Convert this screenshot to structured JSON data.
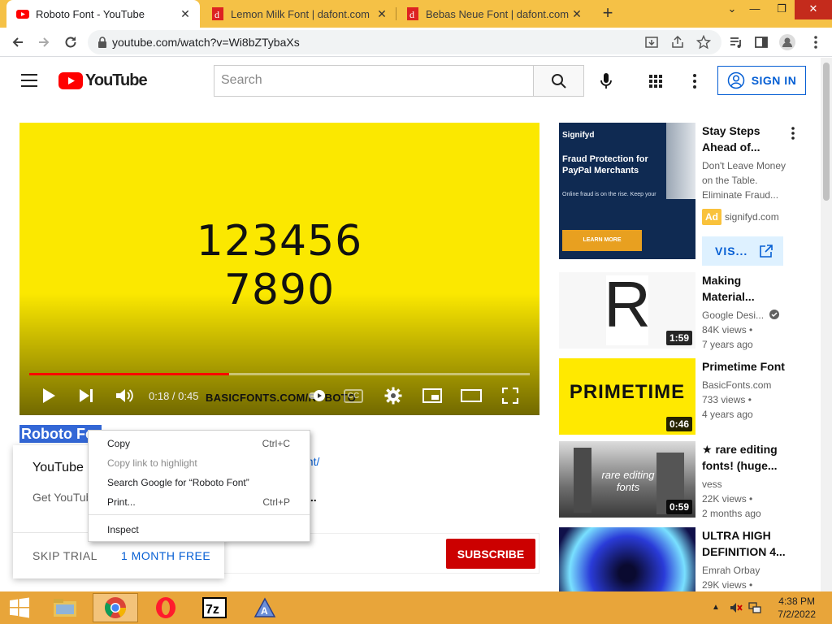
{
  "browser": {
    "tabs": [
      {
        "title": "Roboto Font - YouTube",
        "active": true
      },
      {
        "title": "Lemon Milk Font | dafont.com",
        "active": false
      },
      {
        "title": "Bebas Neue Font | dafont.com",
        "active": false
      }
    ],
    "url": "youtube.com/watch?v=Wi8bZTybaXs"
  },
  "header": {
    "logo_text": "YouTube",
    "search_placeholder": "Search",
    "signin_label": "SIGN IN"
  },
  "player": {
    "line1": "123456",
    "line2": "7890",
    "time": "0:18 / 0:45",
    "watermark": "BASICFONTS.COM/ROBOTO",
    "progress": 0.4,
    "cc_label": "CC"
  },
  "video": {
    "title_visible": "Roboto Fon",
    "link_fragment": "ont/",
    "dots": "...",
    "subscribe_label": "SUBSCRIBE"
  },
  "trial_popup": {
    "title": "YouTube",
    "body": "Get YouTub",
    "skip_label": "SKIP TRIAL",
    "free_label": "1 MONTH FREE"
  },
  "context_menu": {
    "items": [
      {
        "label": "Copy",
        "shortcut": "Ctrl+C",
        "enabled": true
      },
      {
        "label": "Copy link to highlight",
        "shortcut": "",
        "enabled": false
      },
      {
        "label": "Search Google for “Roboto Font”",
        "shortcut": "",
        "enabled": true
      },
      {
        "label": "Print...",
        "shortcut": "Ctrl+P",
        "enabled": true
      },
      {
        "label": "Inspect",
        "shortcut": "",
        "enabled": true
      }
    ]
  },
  "sidebar": {
    "ad": {
      "title": "Stay Steps Ahead of...",
      "desc": "Don't Leave Money on the Table. Eliminate Fraud...",
      "badge": "Ad",
      "domain": "signifyd.com",
      "visit_label": "VIS...",
      "thumb_brand": "Signifyd",
      "thumb_heading": "Fraud Protection for PayPal Merchants",
      "thumb_body": "Online fraud is on the rise. Keep your business protected.",
      "thumb_cta": "LEARN MORE"
    },
    "videos": [
      {
        "title": "Making Material...",
        "channel": "Google Desi...",
        "verified": true,
        "views": "84K views •",
        "age": "7 years ago",
        "duration": "1:59",
        "thumb_text": "R"
      },
      {
        "title": "Primetime Font",
        "channel": "BasicFonts.com",
        "verified": false,
        "views": "733 views •",
        "age": "4 years ago",
        "duration": "0:46",
        "thumb_text": "PRIMETIME"
      },
      {
        "title": "★ rare editing fonts! (huge...",
        "channel": "vess",
        "verified": false,
        "views": "22K views •",
        "age": "2 months ago",
        "duration": "0:59",
        "thumb_text": "rare editing fonts"
      },
      {
        "title": "ULTRA HIGH DEFINITION 4...",
        "channel": "Emrah Orbay",
        "verified": false,
        "views": "29K views •",
        "age": "",
        "duration": "",
        "thumb_text": ""
      }
    ]
  },
  "taskbar": {
    "time": "4:38 PM",
    "date": "7/2/2022"
  },
  "colors": {
    "player_bg": "#fbe800",
    "yt_red": "#ff0000",
    "link_blue": "#065fd4",
    "taskbar": "#e8a53a",
    "tabstrip": "#f5c146"
  }
}
